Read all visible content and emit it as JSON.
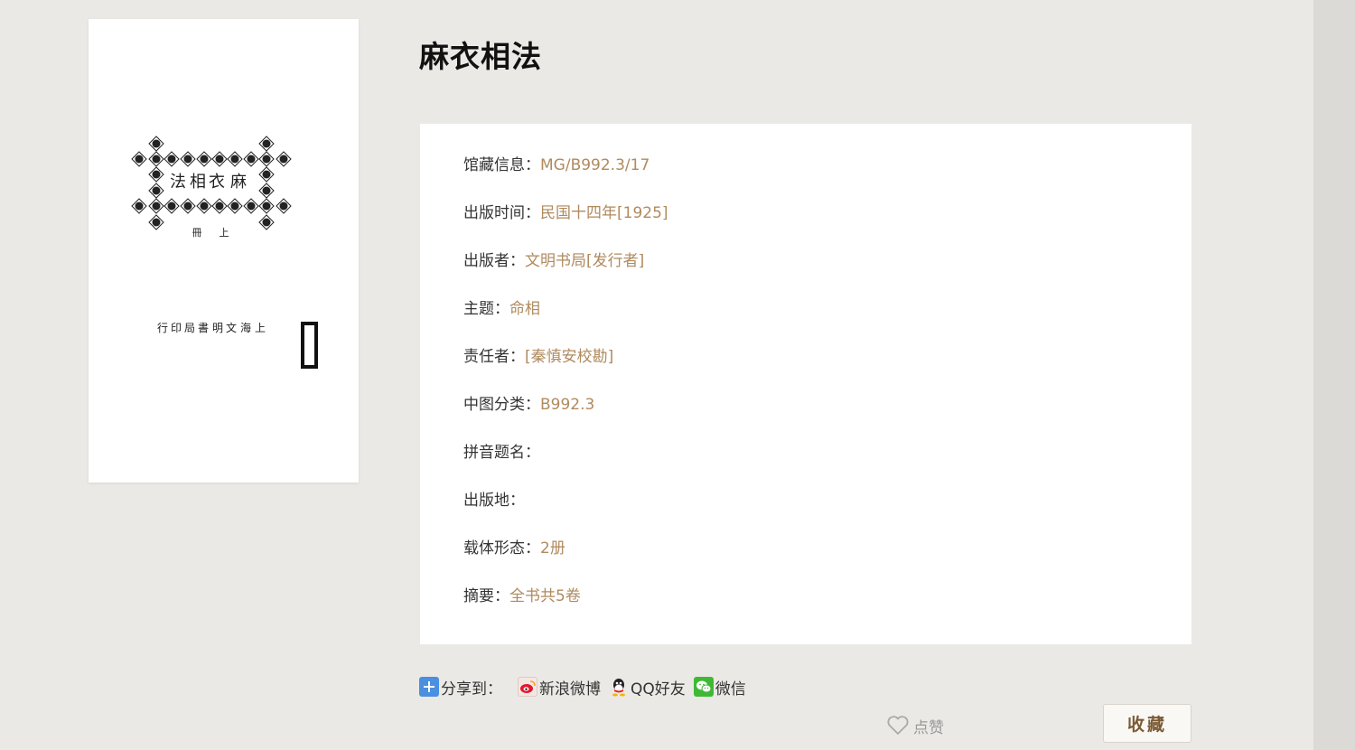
{
  "book": {
    "title": "麻衣相法",
    "cover": {
      "title_chars": [
        "麻",
        "衣",
        "相",
        "法"
      ],
      "volume_chars": [
        "上",
        "冊"
      ],
      "publisher_chars": [
        "上",
        "海",
        "文",
        "明",
        "書",
        "局",
        "印",
        "行"
      ]
    }
  },
  "info": {
    "items": [
      {
        "label": "馆藏信息：",
        "value": "MG/B992.3/17"
      },
      {
        "label": "出版时间：",
        "value": "民国十四年[1925]"
      },
      {
        "label": "出版者：",
        "value": "文明书局[发行者]"
      },
      {
        "label": "主题：",
        "value": "命相"
      },
      {
        "label": "责任者：",
        "value": "[秦慎安校勘]"
      },
      {
        "label": "中图分类：",
        "value": "B992.3"
      },
      {
        "label": "拼音题名：",
        "value": ""
      },
      {
        "label": "出版地：",
        "value": ""
      },
      {
        "label": "载体形态：",
        "value": "2册"
      },
      {
        "label": "摘要：",
        "value": "全书共5卷"
      }
    ]
  },
  "share": {
    "label": "分享到：",
    "targets": [
      {
        "label": "新浪微博",
        "icon": "weibo-icon"
      },
      {
        "label": "QQ好友",
        "icon": "qq-icon"
      },
      {
        "label": "微信",
        "icon": "wechat-icon"
      }
    ]
  },
  "actions": {
    "like_label": "点赞",
    "favorite_label": "收藏"
  },
  "colors": {
    "background": "#ebe9e6",
    "value_text": "#b08a5e",
    "favorite_text": "#7a5a35"
  }
}
